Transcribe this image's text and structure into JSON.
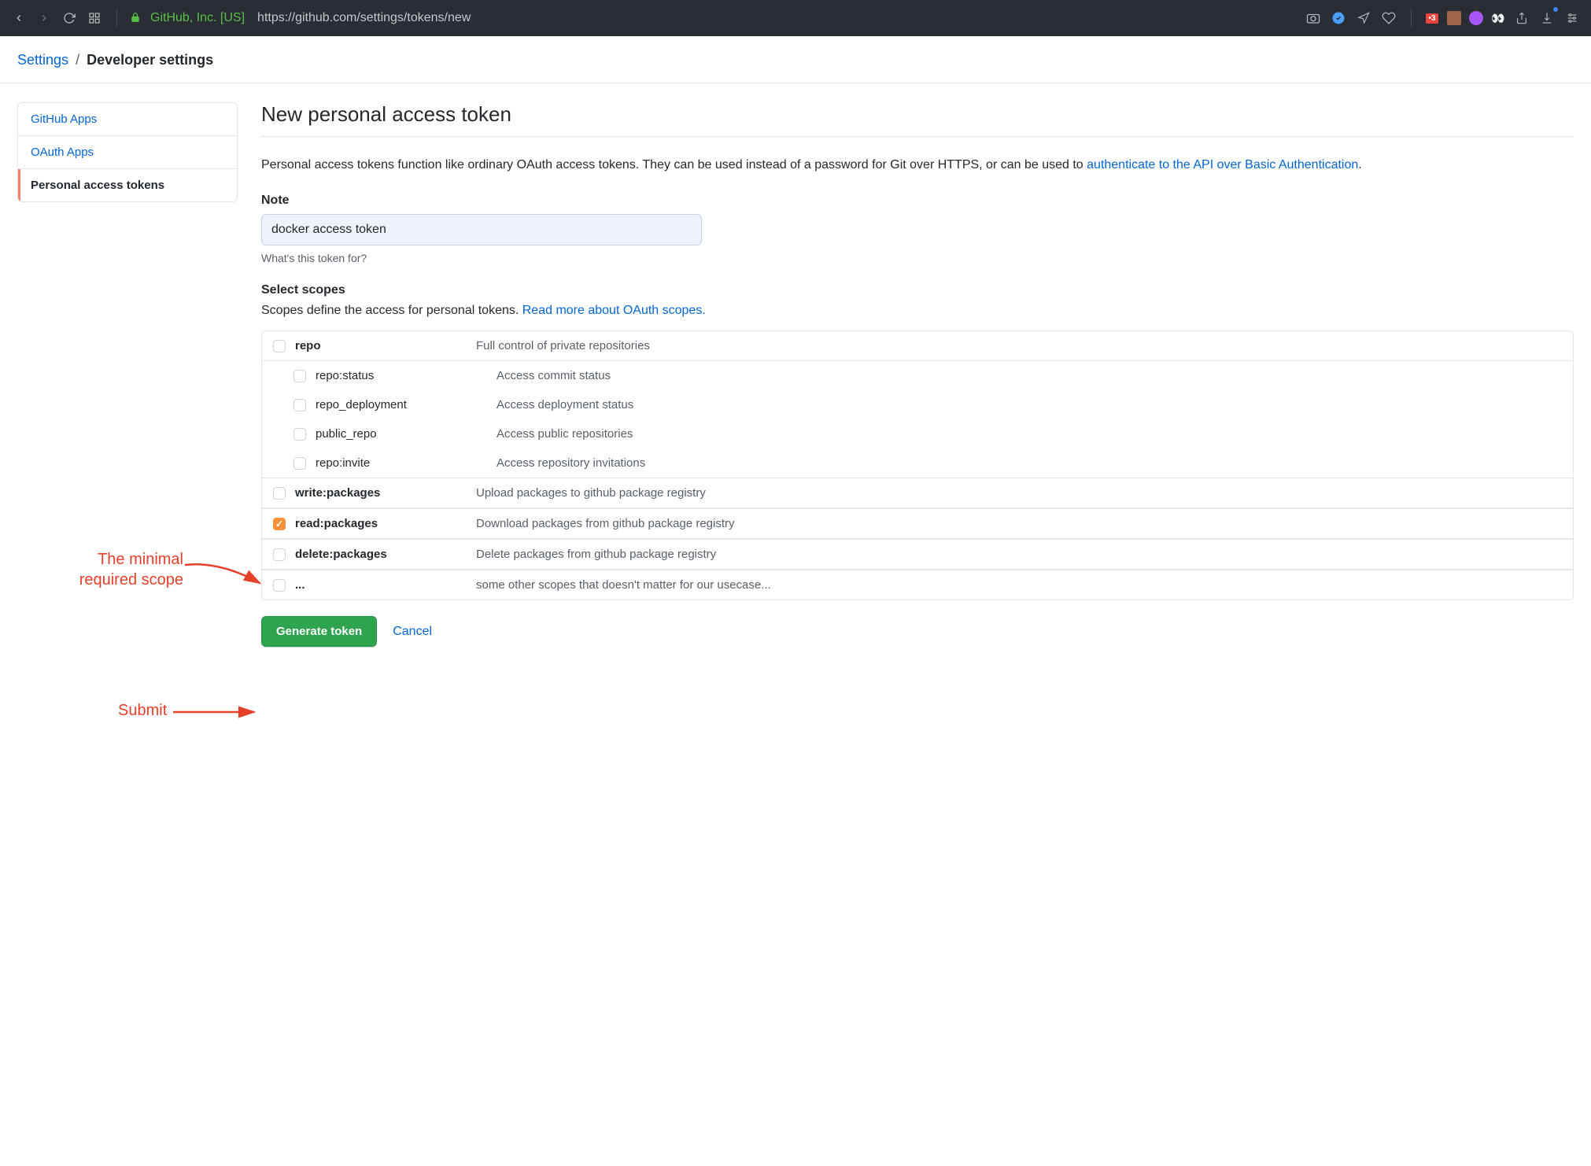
{
  "browser": {
    "site_identity": "GitHub, Inc. [US]",
    "url": "https://github.com/settings/tokens/new",
    "ext_badge": "•3"
  },
  "breadcrumb": {
    "root": "Settings",
    "current": "Developer settings"
  },
  "sidebar": {
    "items": [
      {
        "label": "GitHub Apps"
      },
      {
        "label": "OAuth Apps"
      },
      {
        "label": "Personal access tokens"
      }
    ]
  },
  "page": {
    "title": "New personal access token",
    "lead_pre": "Personal access tokens function like ordinary OAuth access tokens. They can be used instead of a password for Git over HTTPS, or can be used to ",
    "lead_link": "authenticate to the API over Basic Authentication",
    "lead_post": ".",
    "note_label": "Note",
    "note_value": "docker access token",
    "note_help": "What's this token for?",
    "scopes_label": "Select scopes",
    "scopes_sub_pre": "Scopes define the access for personal tokens. ",
    "scopes_sub_link": "Read more about OAuth scopes.",
    "generate": "Generate token",
    "cancel": "Cancel"
  },
  "scopes": [
    {
      "name": "repo",
      "desc": "Full control of private repositories",
      "top": true,
      "bold": true
    },
    {
      "name": "repo:status",
      "desc": "Access commit status",
      "child": true
    },
    {
      "name": "repo_deployment",
      "desc": "Access deployment status",
      "child": true
    },
    {
      "name": "public_repo",
      "desc": "Access public repositories",
      "child": true
    },
    {
      "name": "repo:invite",
      "desc": "Access repository invitations",
      "child": true
    },
    {
      "name": "write:packages",
      "desc": "Upload packages to github package registry",
      "top": true,
      "bold": true,
      "sep": true
    },
    {
      "name": "read:packages",
      "desc": "Download packages from github package registry",
      "top": true,
      "bold": true,
      "checked": true,
      "sep": true
    },
    {
      "name": "delete:packages",
      "desc": "Delete packages from github package registry",
      "top": true,
      "bold": true,
      "sep": true
    },
    {
      "name": "...",
      "desc": "some other scopes that doesn't matter for our usecase...",
      "top": true,
      "sep": true
    }
  ],
  "annotations": {
    "scope": "The minimal required scope",
    "submit": "Submit"
  }
}
